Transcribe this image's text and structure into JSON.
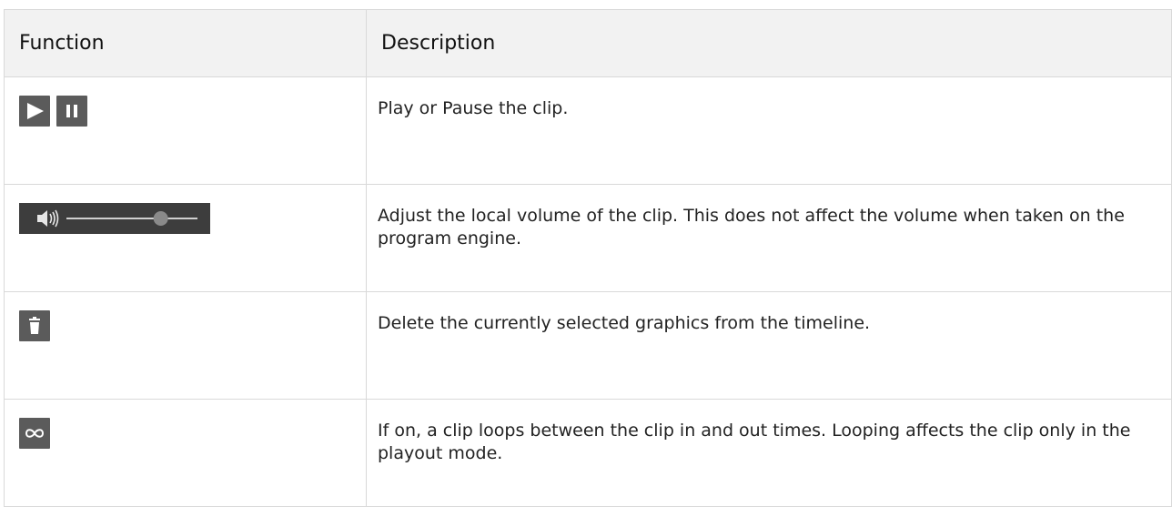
{
  "table": {
    "headers": {
      "function": "Function",
      "description": "Description"
    },
    "rows": [
      {
        "icons": [
          "play-icon",
          "pause-icon"
        ],
        "description": "Play or Pause the clip."
      },
      {
        "icons": [
          "volume-slider"
        ],
        "volume_level": 0.72,
        "description": "Adjust the local volume of the clip. This does not affect the volume when taken on the program engine."
      },
      {
        "icons": [
          "trash-icon"
        ],
        "description": "Delete the currently selected graphics from the timeline."
      },
      {
        "icons": [
          "loop-icon"
        ],
        "description": "If on, a clip loops between the clip in and out times. Looping affects the clip only in the playout mode."
      }
    ]
  },
  "colors": {
    "header_bg": "#f2f2f2",
    "border": "#d9d9d9",
    "button_bg": "#5b5b5b",
    "slider_bg": "#3d3d3d",
    "icon_fg": "#ffffff"
  }
}
